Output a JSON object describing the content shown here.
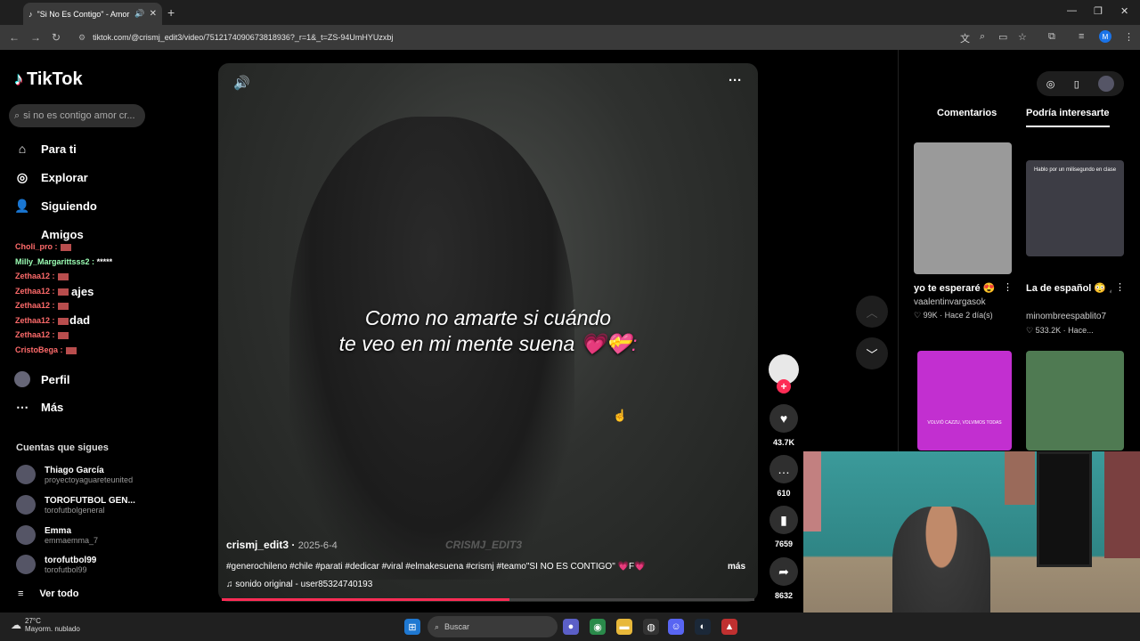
{
  "browser": {
    "tab_title": "\"Si No Es Contigo\" - Amor",
    "new_tab": "+",
    "url": "tiktok.com/@crismj_edit3/video/7512174090673818936?_r=1&_t=ZS-94UmHYUzxbj",
    "profile_initial": "M"
  },
  "sidebar": {
    "logo": "TikTok",
    "search_placeholder": "si no es contigo amor cr...",
    "nav": [
      {
        "label": "Para ti",
        "icon": "home-icon"
      },
      {
        "label": "Explorar",
        "icon": "compass-icon"
      },
      {
        "label": "Siguiendo",
        "icon": "following-icon"
      },
      {
        "label": "Amigos",
        "icon": "friends-icon"
      },
      {
        "label": "Perfil",
        "icon": "profile-icon"
      },
      {
        "label": "Más",
        "icon": "more-icon"
      }
    ],
    "overlapped_nav": [
      "ajes",
      "dad"
    ],
    "chat": [
      {
        "name": "Choli_pro :",
        "text": ""
      },
      {
        "name": "Milly_Margarittsss2 :",
        "text": "*****"
      },
      {
        "name": "Zethaa12 :",
        "text": ""
      },
      {
        "name": "Zethaa12 :",
        "text": ""
      },
      {
        "name": "Zethaa12 :",
        "text": ""
      },
      {
        "name": "Zethaa12 :",
        "text": ""
      },
      {
        "name": "Zethaa12 :",
        "text": ""
      },
      {
        "name": "CristoBega :",
        "text": ""
      }
    ],
    "following_title": "Cuentas que sigues",
    "following": [
      {
        "name": "Thiago García",
        "handle": "proyectoyaguareteunited"
      },
      {
        "name": "TOROFUTBOL GEN...",
        "handle": "torofutbolgeneral"
      },
      {
        "name": "Emma",
        "handle": "emmaemma_7"
      },
      {
        "name": "torofutbol99",
        "handle": "torofutbol99"
      }
    ],
    "see_all": "Ver todo"
  },
  "video": {
    "caption_line1": "Como no amarte si cuándo",
    "caption_line2": "te veo en mi mente suena",
    "caption_hearts": "💗💝:",
    "author": "crismj_edit3",
    "date": "2025-6-4",
    "watermark": "CRISMJ_EDIT3",
    "description": "#generochileno #chile #parati #dedicar #viral #elmakesuena #crismj #teamo\"SI NO ES CONTIGO\" 💗F💗",
    "more": "más",
    "sound": "♫  sonido original - user85324740193",
    "progress": 0.54
  },
  "actions": {
    "likes": "43.7K",
    "comments": "610",
    "saves": "7659",
    "shares": "8632"
  },
  "right_panel": {
    "tab_comments": "Comentarios",
    "tab_interest": "Podría interesarte",
    "items": [
      {
        "title": "yo te esperaré 😍",
        "user": "vaalentinvargasok",
        "meta": "♡ 99K · Hace 2 día(s)",
        "thumb_text": "",
        "color": "#9a9a9a"
      },
      {
        "title": "La de español 😳 🎤#parati #viral...",
        "user": "minombreespablito7",
        "meta": "♡ 533.2K · Hace...",
        "thumb_text": "Hablo por un milisegundo en clase",
        "color": "#3d3d45"
      },
      {
        "title": "",
        "user": "",
        "meta": "",
        "thumb_text": "VOLVIÓ CAZZU, VOLVIMOS TODAS",
        "color": "#c22fd0"
      },
      {
        "title": "",
        "user": "",
        "meta": "",
        "thumb_text": "",
        "color": "#4f7a52"
      }
    ]
  },
  "taskbar": {
    "temp": "27°C",
    "weather": "Mayorm. nublado",
    "search": "Buscar"
  }
}
